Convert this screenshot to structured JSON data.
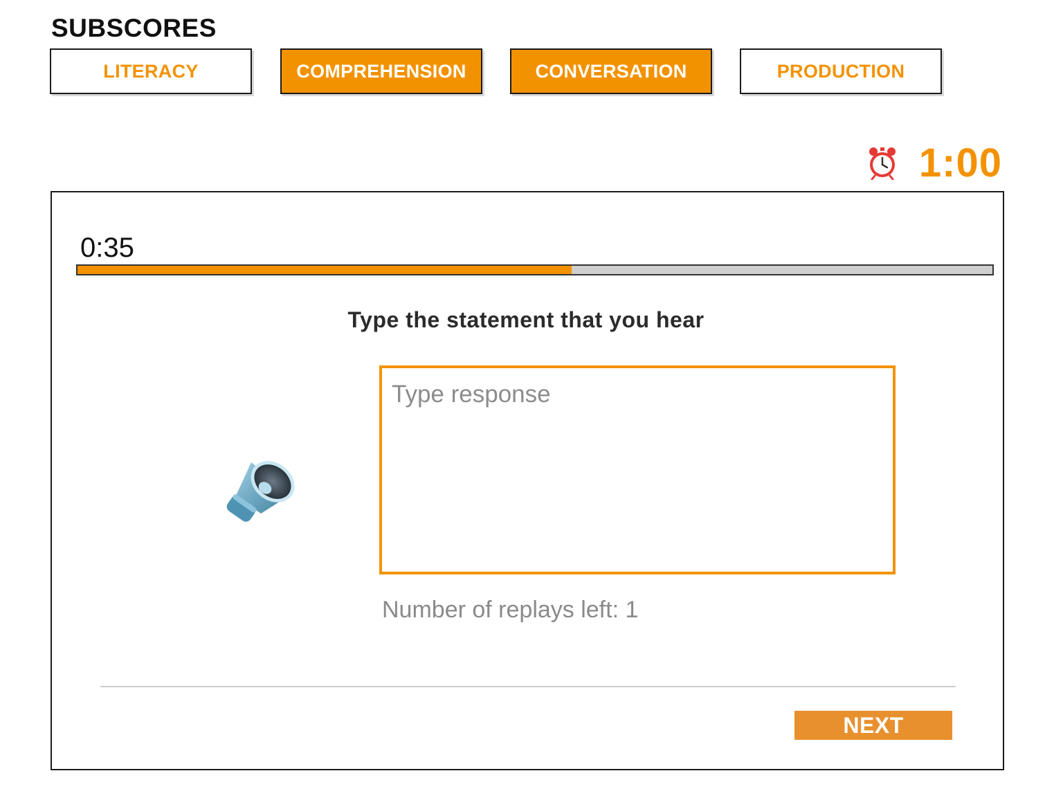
{
  "subscores": {
    "title": "SUBSCORES",
    "tabs": [
      {
        "label": "LITERACY",
        "active": false
      },
      {
        "label": "COMPREHENSION",
        "active": true
      },
      {
        "label": "CONVERSATION",
        "active": true
      },
      {
        "label": "PRODUCTION",
        "active": false
      }
    ]
  },
  "timer": {
    "icon": "alarm-clock-icon",
    "value": "1:00"
  },
  "task": {
    "elapsed": "0:35",
    "progress_fraction": 0.54,
    "instruction": "Type the statement that you hear",
    "audio_icon": "speaker-icon",
    "response_placeholder": "Type response",
    "response_value": "",
    "replays_text": "Number of replays left: 1",
    "next_label": "NEXT"
  },
  "colors": {
    "accent": "#f39200",
    "next_button": "#e8902e",
    "progress_track": "#cfcfcf",
    "clock_red": "#e53935"
  }
}
